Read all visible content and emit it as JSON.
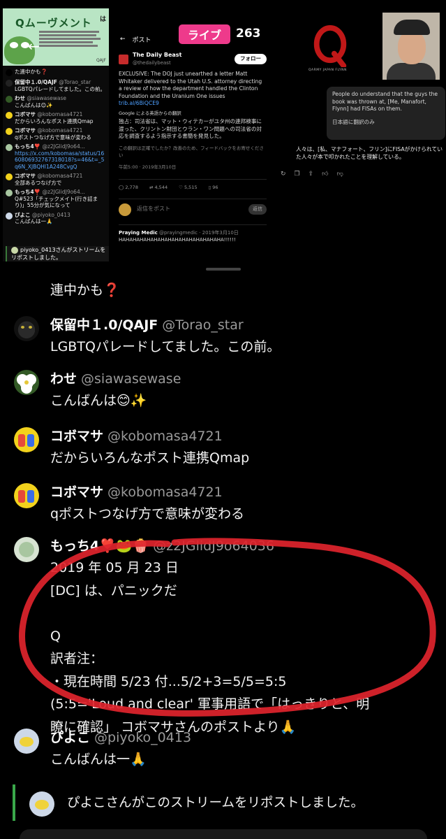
{
  "broadcast": {
    "live_label": "ライブ",
    "viewer_count": "263",
    "left_panel": {
      "title": "Qムーヴメント",
      "title_side": "は",
      "subtitle": "陰謀論\nではない\n雑記",
      "footer": "QAJF",
      "chat": [
        {
          "name": "",
          "handle": "",
          "text": "た連中かも❓",
          "avatar_color": "#000000"
        },
        {
          "name": "保留中１.0/QAJF",
          "handle": "@Torao_star",
          "text": "LGBTQパレードしてました。この前。",
          "avatar_color": "#222222"
        },
        {
          "name": "わせ",
          "handle": "@siawasewase",
          "text": "こんばんは😊✨",
          "avatar_color": "#335a26"
        },
        {
          "name": "コボマサ",
          "handle": "@kobomasa4721",
          "text": "だからいろんなポスト連携Qmap",
          "avatar_color": "#f2d21c"
        },
        {
          "name": "コボマサ",
          "handle": "@kobomasa4721",
          "text": "qポストつなげ方で意味が変わる",
          "avatar_color": "#f2d21c"
        },
        {
          "name": "もっち4❣️",
          "handle": "@z2JGlidJ9o64...",
          "text": "https://x.com/kobomasa/status/1660806932767318018?s=46&t=_5q6N_XJBQHl1A248CvgQ",
          "avatar_color": "#a8c6a0",
          "link": true
        },
        {
          "name": "コボマサ",
          "handle": "@kobomasa4721",
          "text": "全部あるつなげ方で",
          "avatar_color": "#f2d21c"
        },
        {
          "name": "もっち4❣️",
          "handle": "@z2JGlidJ9o64...",
          "text": "Q#523「チェックメイト(行き詰まり)」55分が気になって",
          "avatar_color": "#a8c6a0"
        },
        {
          "name": "ぴよこ",
          "handle": "@piyoko_0413",
          "text": "こんばんは一🙏",
          "avatar_color": "#cdd8e8"
        }
      ],
      "repost": "piyoko_0413さんがストリームをリポストしました。"
    },
    "mid_panel": {
      "header": "ポスト",
      "account_name": "The Daily Beast",
      "account_handle": "@thedailybeast",
      "follow_label": "フォロー",
      "body_en": "EXCLUSIVE: The DOJ just unearthed a letter Matt Whitaker delivered to the Utah U.S. attorney directing a review of how the department handled the Clinton Foundation and the Uranium One issues",
      "link": "trib.al/6BiQCE9",
      "google_translate": "Google による英語からの翻訳",
      "body_ja": "独占：司法省は、マット・ウィテカーがユタ州の連邦検事に渡った、クリントン財団とウラン・ワン問題への司法省の対応を調査するよう指示する書簡を発見した。",
      "feedback": "この翻訳は正確でしたか？改善のため、フィードバックをお寄せください",
      "timestamp": "午前5:00 · 2019年3月10日",
      "stats": [
        "2,778",
        "4,544",
        "5,515",
        "96"
      ],
      "reply_placeholder": "返信をポスト",
      "reply_button": "返信",
      "quoted_name": "Praying Medic",
      "quoted_handle": "@prayingmedic · 2019年3月10日",
      "quoted_text": "HAHAHAHAHAHAHAHAHAHAHAHAHAHAHA!!!!!!"
    },
    "right_panel": {
      "logo_text": "QARMY JAPAN FLYNN",
      "translate_source": "People do understand that the guys the book was thrown at, [Me, Manafort, Flynn] had FISAs on them.",
      "translate_note": "日本語に翻訳のみ",
      "translate_result": "人々は、[私、マナフォート、フリン]にFISAがかけられていた人々が本で叩かれたことを理解している。"
    }
  },
  "chat": {
    "continued_text": "連中かも",
    "continued_mark": "❓",
    "messages": [
      {
        "name": "保留中１.0/QAJF",
        "handle": "@Torao_star",
        "lines": "LGBTQパレードしてました。この前。"
      },
      {
        "name": "わせ",
        "handle": "@siawasewase",
        "lines": "こんばんは😊✨"
      },
      {
        "name": "コボマサ",
        "handle": "@kobomasa4721",
        "lines": "だからいろんなポスト連携Qmap"
      },
      {
        "name": "コボマサ",
        "handle": "@kobomasa4721",
        "lines": "qポストつなげ方で意味が変わる"
      },
      {
        "name": "もっち4❣️🐸🍿",
        "handle": "@z2JGlidJ9o64036",
        "lines": "2019 年 05 月 23 日\n[DC] は、パニックだ\n\nQ\n訳者注：\n・現在時間 5/23 付...5/2+3=5/5=5:5\n(5:5='Loud and clear' 軍事用語で「はっきりと、明\n瞭に確認」 コボマサさんのポストより🙏"
      },
      {
        "name": "ぴよこ",
        "handle": "@piyoko_0413",
        "lines": "こんばんは一🙏"
      }
    ],
    "repost_notice": "ぴよこさんがこのストリームをリポストしました。"
  },
  "colors": {
    "live_badge": "#ee3a8b",
    "handle_gray": "#9a9a9a",
    "annotation_red": "#e0242c",
    "repost_green": "#3aa84a"
  }
}
